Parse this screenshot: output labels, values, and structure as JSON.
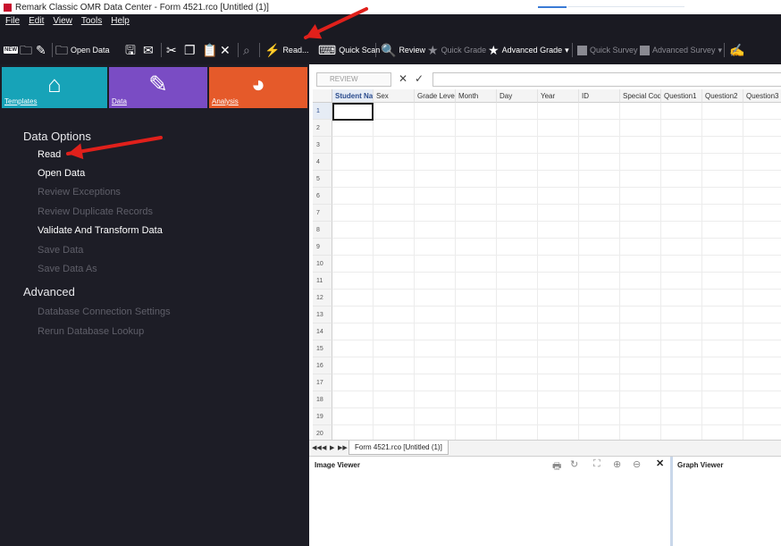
{
  "window": {
    "title": "Remark Classic OMR Data Center - Form 4521.rco [Untitled (1)]"
  },
  "menu": [
    "File",
    "Edit",
    "View",
    "Tools",
    "Help"
  ],
  "toolbar": {
    "new_badge": "NEW",
    "open_data": "Open Data",
    "read": "Read...",
    "quick_scan": "Quick Scan",
    "review": "Review",
    "quick_grade": "Quick Grade",
    "advanced_grade": "Advanced Grade",
    "quick_survey": "Quick Survey",
    "advanced_survey": "Advanced Survey",
    "dropdown_glyph": "▾"
  },
  "tiles": {
    "templates": "Templates",
    "data": "Data",
    "analysis": "Analysis",
    "templates_color": "#17a3b8",
    "data_color": "#7a4cc4",
    "analysis_color": "#e55a2a"
  },
  "left": {
    "data_options_heading": "Data Options",
    "read": "Read",
    "open_data": "Open Data",
    "review_exceptions": "Review Exceptions",
    "review_duplicate_records": "Review Duplicate Records",
    "validate_transform": "Validate And Transform Data",
    "save_data": "Save Data",
    "save_data_as": "Save Data As",
    "advanced_heading": "Advanced",
    "db_connection": "Database Connection Settings",
    "rerun_lookup": "Rerun Database Lookup"
  },
  "formula": {
    "review_button": "REVIEW",
    "cancel": "✕",
    "confirm": "✓"
  },
  "grid": {
    "columns": [
      "Student Nar",
      "Sex",
      "Grade Level",
      "Month",
      "Day",
      "Year",
      "ID",
      "Special Code",
      "Question1",
      "Question2",
      "Question3"
    ],
    "rows": [
      "1",
      "2",
      "3",
      "4",
      "5",
      "6",
      "7",
      "8",
      "9",
      "10",
      "11",
      "12",
      "13",
      "14",
      "15",
      "16",
      "17",
      "18",
      "19",
      "20"
    ]
  },
  "sheet": {
    "tab": "Form 4521.rco [Untitled (1)]",
    "nav_first": "◀◀",
    "nav_prev": "◀",
    "nav_next": "▶",
    "nav_last": "▶▶"
  },
  "viewers": {
    "image_viewer": "Image Viewer",
    "graph_viewer": "Graph Viewer",
    "print_glyph": "🖶",
    "rotate_glyph": "↻",
    "fit_glyph": "⛶",
    "zoom_in_glyph": "⊕",
    "zoom_out_glyph": "⊖",
    "close_glyph": "✕"
  },
  "annotations": {
    "arrow_color": "#e0201b"
  }
}
